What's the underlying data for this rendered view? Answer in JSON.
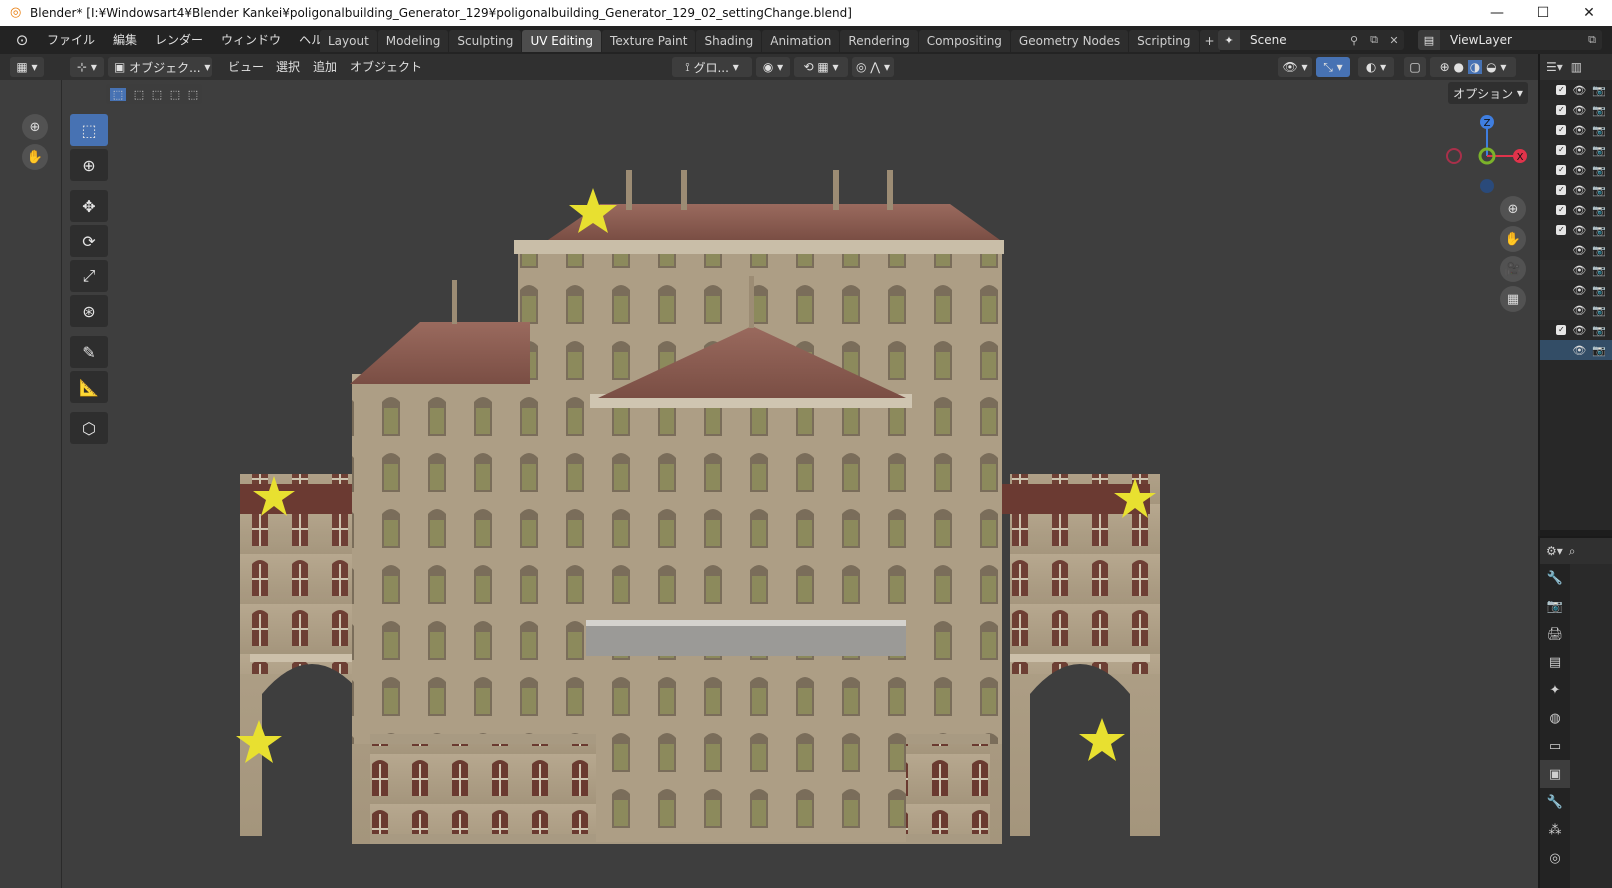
{
  "window": {
    "title": "Blender* [I:¥Windowsart4¥Blender Kankei¥poligonalbuilding_Generator_129¥poligonalbuilding_Generator_129_02_settingChange.blend]",
    "minimize": "—",
    "maximize": "☐",
    "close": "✕"
  },
  "menu": {
    "file": "ファイル",
    "edit": "編集",
    "render": "レンダー",
    "window": "ウィンドウ",
    "help": "ヘルプ"
  },
  "workspaces": [
    "Layout",
    "Modeling",
    "Sculpting",
    "UV Editing",
    "Texture Paint",
    "Shading",
    "Animation",
    "Rendering",
    "Compositing",
    "Geometry Nodes",
    "Scripting"
  ],
  "active_workspace": "UV Editing",
  "scene": {
    "name": "Scene"
  },
  "view_layer": {
    "name": "ViewLayer"
  },
  "viewport_header": {
    "mode": "オブジェク...",
    "view": "ビュー",
    "select": "選択",
    "add": "追加",
    "object": "オブジェクト",
    "transform_orientation": "グロ...",
    "options": "オプション"
  },
  "gizmo": {
    "z": "Z",
    "x": "X"
  },
  "colors": {
    "accent_blue": "#4772b3",
    "gizmo_x": "#e0334b",
    "gizmo_y": "#7bb22a",
    "gizmo_z": "#3f7ee0",
    "star": "#e8e030",
    "viewport_bg": "#3e3e3e"
  },
  "icons": {
    "tools": [
      "select-box-icon",
      "cursor-icon",
      "move-icon",
      "rotate-icon",
      "scale-icon",
      "transform-icon",
      "annotate-icon",
      "measure-icon",
      "add-cube-icon"
    ],
    "nav": [
      "zoom-icon",
      "hand-pan-icon",
      "camera-icon",
      "grid-icon"
    ]
  },
  "outliner_rows": [
    {
      "checked": true
    },
    {
      "checked": true
    },
    {
      "checked": true
    },
    {
      "checked": true
    },
    {
      "checked": true
    },
    {
      "checked": true
    },
    {
      "checked": true
    },
    {
      "checked": true
    },
    {
      "checked": false
    },
    {
      "checked": false
    },
    {
      "checked": false
    },
    {
      "checked": false
    },
    {
      "checked": true
    },
    {
      "checked": false,
      "selected": true
    }
  ]
}
